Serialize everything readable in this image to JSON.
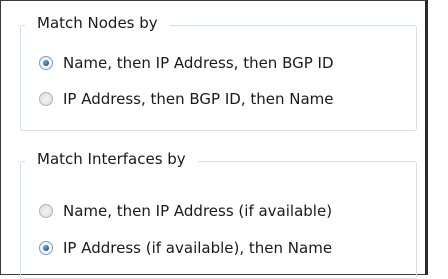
{
  "nodes_group": {
    "title": "Match Nodes by",
    "options": [
      {
        "label": "Name, then IP Address, then BGP ID",
        "selected": true
      },
      {
        "label": "IP Address, then BGP ID, then Name",
        "selected": false
      }
    ]
  },
  "interfaces_group": {
    "title": "Match Interfaces by",
    "options": [
      {
        "label": "Name, then IP Address (if available)",
        "selected": false
      },
      {
        "label": "IP Address (if available), then Name",
        "selected": true
      }
    ]
  },
  "colors": {
    "group_border": "#d5dfe5",
    "radio_selected_dot": "#1f5c9c"
  }
}
